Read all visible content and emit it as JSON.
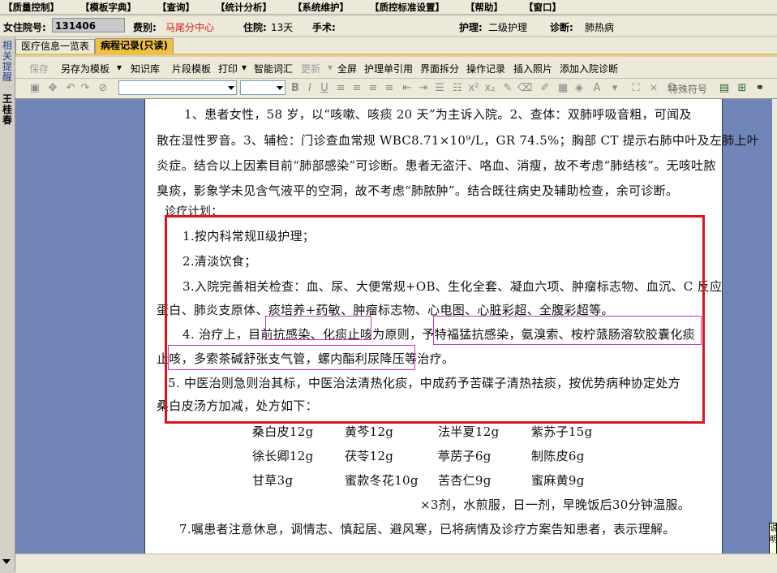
{
  "menu": [
    "【质量控制】",
    "【模板字典】",
    "【查询】",
    "【统计分析】",
    "【系统维护】",
    "【质控标准设置】",
    "【帮助】",
    "【窗口】"
  ],
  "patient": {
    "id_label": "女住院号:",
    "id_value": "131406",
    "dept_label": "费别:",
    "dept_value": "马尾分中心",
    "stay_label": "住院:",
    "stay_value": "13天",
    "surgery_label": "手术:",
    "nursing_label": "护理:",
    "nursing_value": "二级护理",
    "diag_label": "诊断:",
    "diag_value": "肺热病",
    "accent_color": "#d11a1a"
  },
  "left_panel": {
    "tab1": "相关提醒",
    "tab2": "王桂春"
  },
  "tabs": [
    "医疗信息一览表",
    "病程记录(只读)"
  ],
  "toolbar1": {
    "save": "保存",
    "save_template": "另存为模板",
    "knowledge": "知识库",
    "fragment": "片段模板",
    "print": "打印",
    "smart_words": "智能词汇",
    "update": "更新",
    "fullscreen": "全屏",
    "nursing_ref": "护理单引用",
    "split": "界面拆分",
    "op_log": "操作记录",
    "insert_photo": "插入照片",
    "add_diag": "添加入院诊断"
  },
  "toolbar2": {
    "special_symbol": "特殊符号"
  },
  "doc": {
    "p1_l1": "1、患者女性，58 岁，以“咳嗽、咳痰 20 天”为主诉入院。2、查体：双肺呼吸音粗，可闻及",
    "p1_l2": "散在湿性罗音。3、辅检：门诊查血常规 WBC8.71×10⁹/L，GR 74.5%；胸部 CT 提示右肺中叶及左肺上叶",
    "p1_l3": "炎症。结合以上因素目前“肺部感染”可诊断。患者无盗汗、咯血、消瘦，故不考虑“肺结核”。无咳吐脓",
    "p1_l4": "臭痰，影象学未见含气液平的空洞，故不考虑“肺脓肿”。结合既往病史及辅助检查，余可诊断。",
    "plan_title": "诊疗计划：",
    "i1": "1.按内科常规Ⅱ级护理；",
    "i2": "2.清淡饮食；",
    "i3_l1": "3.入院完善相关检查：血、尿、大便常规+OB、生化全套、凝血六项、肿瘤标志物、血沉、C 反应",
    "i3_l2": "蛋白、肺炎支原体、痰培养+药敏、肿瘤标志物、心电图、心脏彩超、全腹彩超等。",
    "i4_l1": "4. 治疗上，目前抗感染、化痰止咳为原则，予特福猛抗感染，氨溴索、桉柠蒎肠溶软胶囊化痰",
    "i4_l2": "止咳，多索茶碱舒张支气管，螺内酯利尿降压等治疗。",
    "i5_l1": "5. 中医治则急则治其标，中医治法清热化痰，中成药予苦碟子清热祛痰，按优势病种协定处方",
    "i5_l2": "桑白皮汤方加减，处方如下：",
    "herbs": [
      "桑白皮12g",
      "黄芩12g",
      "法半夏12g",
      "紫苏子15g",
      "徐长卿12g",
      "茯苓12g",
      "葶苈子6g",
      "制陈皮6g",
      "甘草3g",
      "蜜款冬花10g",
      "苦杏仁9g",
      "蜜麻黄9g"
    ],
    "dosage": "×3剂，水煎服，日一剂，早晚饭后30分钟温服。",
    "i7": "7.嘱患者注意休息，调情志、慎起居、避风寒，已将病情及诊疗方案告知患者，表示理解。"
  },
  "tooltip_text": "说明"
}
